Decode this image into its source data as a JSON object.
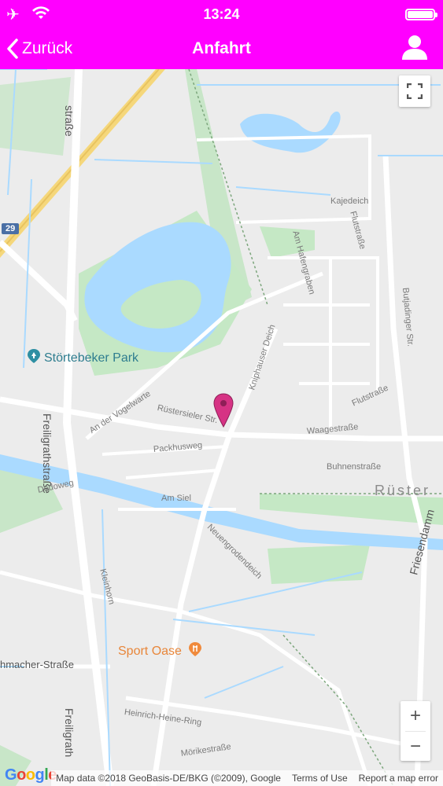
{
  "status_bar": {
    "time": "13:24"
  },
  "nav": {
    "back_label": "Zurück",
    "title": "Anfahrt"
  },
  "map": {
    "area_label": "Rüster",
    "route_badge": "29",
    "pois": {
      "park": "Störtebeker Park",
      "sport": "Sport Oase"
    },
    "streets": {
      "strasse_left": "straße",
      "freiligrath_upper": "Freiligrathstraße",
      "freiligrath_lower": "Freiligrath",
      "flutstrasse_v": "Flutstraße",
      "kajedeich": "Kajedeich",
      "am_hafengraben": "Am Hafengraben",
      "butjadinger": "Butjadinger Str.",
      "kniphauser_deich": "Kniphauser Deich",
      "an_der_vogelwarte": "An der Vogelwarte",
      "ruestersieler": "Rüstersieler Str.",
      "packhusweg": "Packhusweg",
      "waagestrasse": "Waagestraße",
      "flutstrasse_h": "Flutstraße",
      "buhnenstrasse": "Buhnenstraße",
      "dodoweg": "Dodoweg",
      "am_siel": "Am Siel",
      "neuengrodendeich": "Neuengrodendeich",
      "kleinhorn": "Kleinhorn",
      "friesendamm": "Friesendamm",
      "schumacher": "hmacher-Straße",
      "heinrich_heine": "Heinrich-Heine-Ring",
      "moerike": "Mörikestraße"
    },
    "zoom_in": "+",
    "zoom_out": "−",
    "google_logo": "Google",
    "attribution_text": "Map data ©2018 GeoBasis-DE/BKG (©2009), Google",
    "terms_link": "Terms of Use",
    "report_link": "Report a map error"
  },
  "colors": {
    "accent": "#ff00ff",
    "water": "#aadaff",
    "park": "#c5e8c5",
    "pin": "#d63384"
  },
  "icons": [
    "airplane-icon",
    "wifi-icon",
    "battery-icon",
    "chevron-left-icon",
    "user-icon",
    "fullscreen-icon",
    "park-pin-icon",
    "sport-pin-icon",
    "location-pin-icon"
  ]
}
